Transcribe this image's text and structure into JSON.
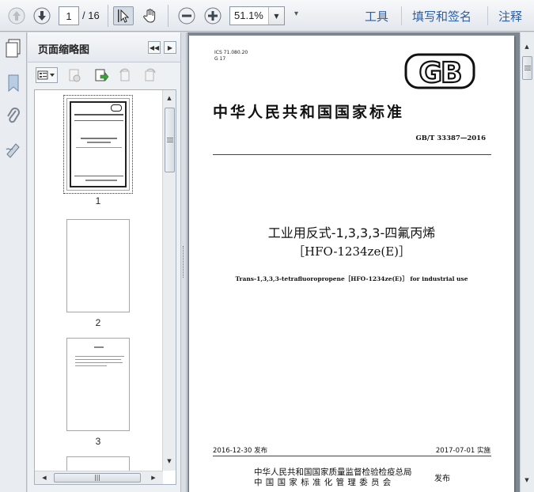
{
  "toolbar": {
    "current_page": "1",
    "total_pages": "/ 16",
    "zoom": "51.1%",
    "tools_label": "工具",
    "sign_label": "填写和签名",
    "comment_label": "注释"
  },
  "sidebar": {
    "title": "页面缩略图",
    "thumbnails": [
      {
        "number": "1"
      },
      {
        "number": "2"
      },
      {
        "number": "3"
      }
    ]
  },
  "document": {
    "ics": "ICS 71.080.20",
    "ccs": "G 17",
    "logo": "GB",
    "standard_title": "中华人民共和国国家标准",
    "standard_no": "GB/T 33387—2016",
    "title_cn": "工业用反式-1,3,3,3-四氟丙烯",
    "title_code": "［HFO-1234ze(E)］",
    "title_en": "Trans-1,3,3,3-tetrafluoropropene［HFO-1234ze(E)］ for industrial use",
    "publish_date": "2016-12-30 发布",
    "implement_date": "2017-07-01 实施",
    "issuer_1": "中华人民共和国国家质量监督检验检疫总局",
    "issuer_2": "中国国家标准化管理委员会",
    "issue_word": "发布"
  }
}
